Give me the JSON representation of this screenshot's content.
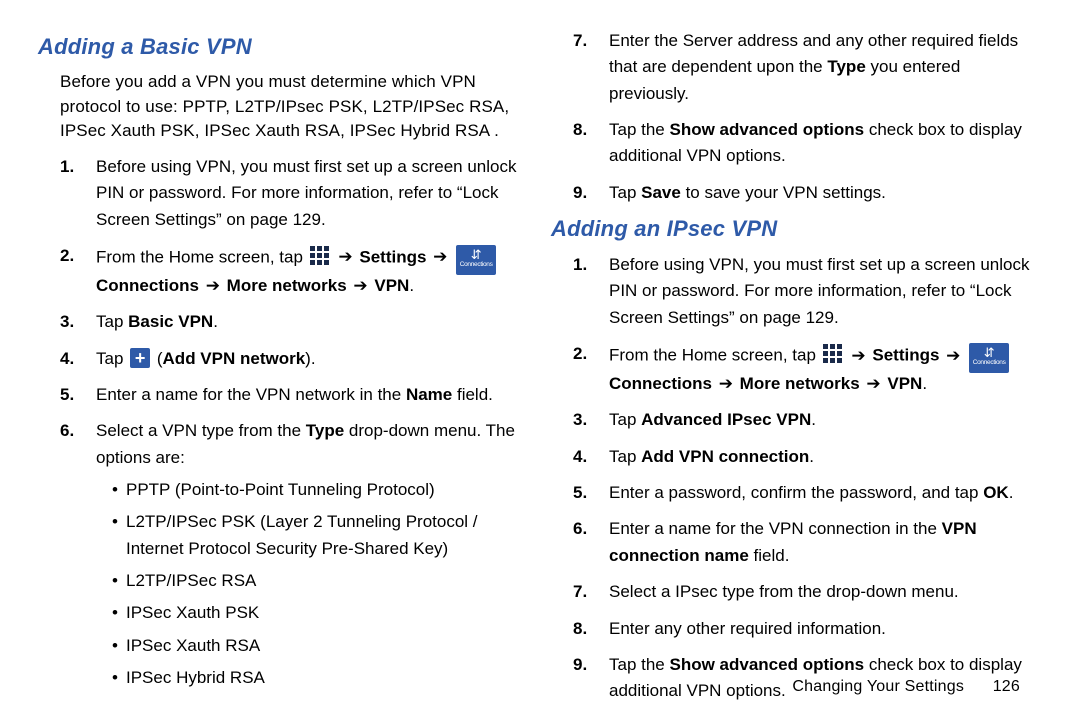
{
  "left": {
    "heading": "Adding a Basic VPN",
    "intro": "Before you add a VPN you must determine which VPN protocol to use: PPTP, L2TP/IPsec PSK, L2TP/IPSec RSA, IPSec Xauth PSK, IPSec Xauth RSA, IPSec Hybrid RSA .",
    "step1_a": "Before using VPN, you must first set up a screen unlock PIN or password. For more information, refer to ",
    "step1_ref": "Lock Screen Settings",
    "step1_b": " on page 129.",
    "step2_a": "From the Home screen, tap ",
    "label_settings": "Settings",
    "label_connections": "Connections",
    "label_more_networks": "More networks",
    "label_vpn": "VPN",
    "step3_a": "Tap ",
    "step3_b": "Basic VPN",
    "step4_a": "Tap ",
    "step4_b": "Add VPN network",
    "step5_a": "Enter a name for the VPN network in the ",
    "step5_b": "Name",
    "step5_c": " field.",
    "step6_a": "Select a VPN type from the ",
    "step6_b": "Type",
    "step6_c": " drop-down menu. The options are:",
    "bullets": [
      "PPTP (Point-to-Point Tunneling Protocol)",
      "L2TP/IPSec PSK (Layer 2 Tunneling Protocol / Internet Protocol Security Pre-Shared Key)",
      "L2TP/IPSec RSA",
      "IPSec Xauth PSK",
      "IPSec Xauth RSA",
      "IPSec Hybrid RSA"
    ]
  },
  "right": {
    "step7_a": "Enter the Server address and any other required fields that are dependent upon the ",
    "step7_b": "Type",
    "step7_c": " you entered previously.",
    "step8_a": "Tap the ",
    "step8_b": "Show advanced options",
    "step8_c": " check box to display additional VPN options.",
    "step9_a": "Tap ",
    "step9_b": "Save",
    "step9_c": " to save your VPN settings.",
    "heading": "Adding an IPsec VPN",
    "s1_a": "Before using VPN, you must first set up a screen unlock PIN or password. For more information, refer to ",
    "s1_ref": "Lock Screen Settings",
    "s1_b": " on page 129.",
    "s2_a": "From the Home screen, tap ",
    "label_settings": "Settings",
    "label_connections": "Connections",
    "label_more_networks": "More networks",
    "label_vpn": "VPN",
    "s3_a": "Tap ",
    "s3_b": "Advanced IPsec VPN",
    "s4_a": "Tap ",
    "s4_b": "Add VPN connection",
    "s5_a": "Enter a password, confirm the password, and tap ",
    "s5_b": "OK",
    "s6_a": "Enter a name for the VPN connection in the ",
    "s6_b": "VPN connection name",
    "s6_c": " field.",
    "s7": "Select a IPsec type from the drop-down menu.",
    "s8": "Enter any other required information.",
    "s9_a": "Tap the ",
    "s9_b": "Show advanced options",
    "s9_c": " check box to display additional VPN options."
  },
  "icons": {
    "connections_label": "Connections",
    "arrow": "➔"
  },
  "footer": {
    "chapter": "Changing Your Settings",
    "page": "126"
  }
}
